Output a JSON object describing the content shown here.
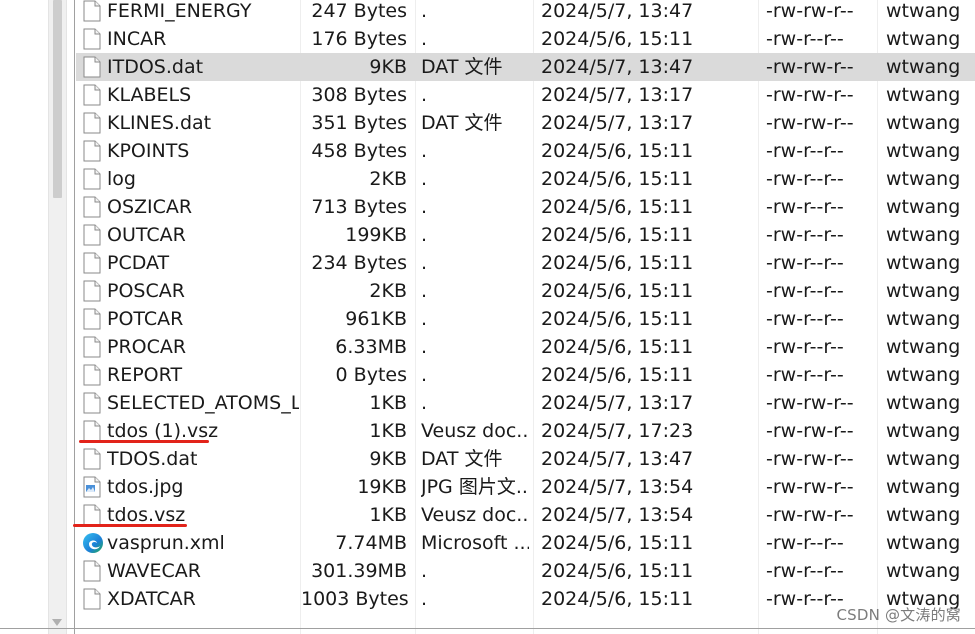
{
  "files": [
    {
      "name": "FERMI_ENERGY",
      "size": "247 Bytes",
      "type": ".",
      "modified": "2024/5/7, 13:47",
      "perms": "-rw-rw-r--",
      "owner": "wtwang",
      "icon": "file-icon"
    },
    {
      "name": "INCAR",
      "size": "176 Bytes",
      "type": ".",
      "modified": "2024/5/6, 15:11",
      "perms": "-rw-r--r--",
      "owner": "wtwang",
      "icon": "file-icon"
    },
    {
      "name": "ITDOS.dat",
      "size": "9KB",
      "type": "DAT 文件",
      "modified": "2024/5/7, 13:47",
      "perms": "-rw-rw-r--",
      "owner": "wtwang",
      "icon": "file-icon",
      "selected": true
    },
    {
      "name": "KLABELS",
      "size": "308 Bytes",
      "type": ".",
      "modified": "2024/5/7, 13:17",
      "perms": "-rw-rw-r--",
      "owner": "wtwang",
      "icon": "file-icon"
    },
    {
      "name": "KLINES.dat",
      "size": "351 Bytes",
      "type": "DAT 文件",
      "modified": "2024/5/7, 13:17",
      "perms": "-rw-rw-r--",
      "owner": "wtwang",
      "icon": "file-icon"
    },
    {
      "name": "KPOINTS",
      "size": "458 Bytes",
      "type": ".",
      "modified": "2024/5/6, 15:11",
      "perms": "-rw-r--r--",
      "owner": "wtwang",
      "icon": "file-icon"
    },
    {
      "name": "log",
      "size": "2KB",
      "type": ".",
      "modified": "2024/5/6, 15:11",
      "perms": "-rw-r--r--",
      "owner": "wtwang",
      "icon": "file-icon"
    },
    {
      "name": "OSZICAR",
      "size": "713 Bytes",
      "type": ".",
      "modified": "2024/5/6, 15:11",
      "perms": "-rw-r--r--",
      "owner": "wtwang",
      "icon": "file-icon"
    },
    {
      "name": "OUTCAR",
      "size": "199KB",
      "type": ".",
      "modified": "2024/5/6, 15:11",
      "perms": "-rw-r--r--",
      "owner": "wtwang",
      "icon": "file-icon"
    },
    {
      "name": "PCDAT",
      "size": "234 Bytes",
      "type": ".",
      "modified": "2024/5/6, 15:11",
      "perms": "-rw-r--r--",
      "owner": "wtwang",
      "icon": "file-icon"
    },
    {
      "name": "POSCAR",
      "size": "2KB",
      "type": ".",
      "modified": "2024/5/6, 15:11",
      "perms": "-rw-r--r--",
      "owner": "wtwang",
      "icon": "file-icon"
    },
    {
      "name": "POTCAR",
      "size": "961KB",
      "type": ".",
      "modified": "2024/5/6, 15:11",
      "perms": "-rw-r--r--",
      "owner": "wtwang",
      "icon": "file-icon"
    },
    {
      "name": "PROCAR",
      "size": "6.33MB",
      "type": ".",
      "modified": "2024/5/6, 15:11",
      "perms": "-rw-r--r--",
      "owner": "wtwang",
      "icon": "file-icon"
    },
    {
      "name": "REPORT",
      "size": "0 Bytes",
      "type": ".",
      "modified": "2024/5/6, 15:11",
      "perms": "-rw-r--r--",
      "owner": "wtwang",
      "icon": "file-icon"
    },
    {
      "name": "SELECTED_ATOMS_L...",
      "size": "1KB",
      "type": ".",
      "modified": "2024/5/7, 13:17",
      "perms": "-rw-rw-r--",
      "owner": "wtwang",
      "icon": "file-icon"
    },
    {
      "name": "tdos (1).vsz",
      "size": "1KB",
      "type": "Veusz doc...",
      "modified": "2024/5/7, 17:23",
      "perms": "-rw-rw-r--",
      "owner": "wtwang",
      "icon": "file-icon",
      "annotated": true
    },
    {
      "name": "TDOS.dat",
      "size": "9KB",
      "type": "DAT 文件",
      "modified": "2024/5/7, 13:47",
      "perms": "-rw-rw-r--",
      "owner": "wtwang",
      "icon": "file-icon"
    },
    {
      "name": "tdos.jpg",
      "size": "19KB",
      "type": "JPG 图片文...",
      "modified": "2024/5/7, 13:54",
      "perms": "-rw-rw-r--",
      "owner": "wtwang",
      "icon": "image-file-icon"
    },
    {
      "name": "tdos.vsz",
      "size": "1KB",
      "type": "Veusz doc...",
      "modified": "2024/5/7, 13:54",
      "perms": "-rw-rw-r--",
      "owner": "wtwang",
      "icon": "file-icon",
      "annotated": true
    },
    {
      "name": "vasprun.xml",
      "size": "7.74MB",
      "type": "Microsoft ...",
      "modified": "2024/5/6, 15:11",
      "perms": "-rw-r--r--",
      "owner": "wtwang",
      "icon": "edge-browser-icon"
    },
    {
      "name": "WAVECAR",
      "size": "301.39MB",
      "type": ".",
      "modified": "2024/5/6, 15:11",
      "perms": "-rw-r--r--",
      "owner": "wtwang",
      "icon": "file-icon"
    },
    {
      "name": "XDATCAR",
      "size": "1003 Bytes",
      "type": ".",
      "modified": "2024/5/6, 15:11",
      "perms": "-rw-r--r--",
      "owner": "wtwang",
      "icon": "file-icon"
    }
  ],
  "watermark": "CSDN @文涛的窝",
  "colors": {
    "selected_row": "#dadada",
    "annotation": "#e2231a",
    "text": "#1a1a1a",
    "watermark": "#7c7c7c"
  }
}
